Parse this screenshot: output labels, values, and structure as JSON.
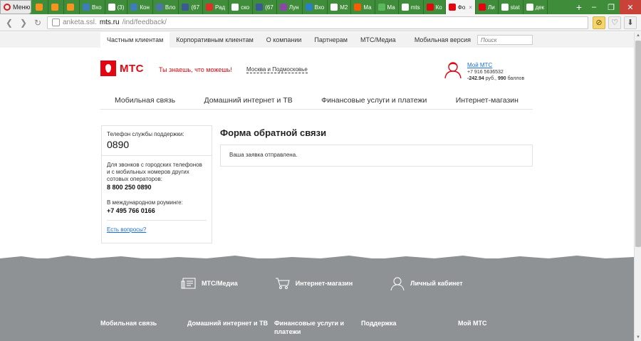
{
  "browser": {
    "menu_label": "Меню",
    "tabs": [
      {
        "label": "",
        "color": "#f7931e"
      },
      {
        "label": "",
        "color": "#f7931e"
      },
      {
        "label": "",
        "color": "#f7931e"
      },
      {
        "label": "Вхо",
        "color": "#3e7bbf"
      },
      {
        "label": "(3)",
        "color": "#ffffff"
      },
      {
        "label": "Кон",
        "color": "#3e7bbf"
      },
      {
        "label": "Вло",
        "color": "#4a76a8"
      },
      {
        "label": "(67",
        "color": "#3b5998"
      },
      {
        "label": "Рад",
        "color": "#e52d27"
      },
      {
        "label": "ско",
        "color": "#ffffff"
      },
      {
        "label": "(67",
        "color": "#3b5998"
      },
      {
        "label": "Лун",
        "color": "#8e44ad"
      },
      {
        "label": "Вхо",
        "color": "#2a7fc9"
      },
      {
        "label": "М2",
        "color": "#ffffff"
      },
      {
        "label": "Ма",
        "color": "#ff5a00"
      },
      {
        "label": "Ма",
        "color": "#5cb85c"
      },
      {
        "label": "mts",
        "color": "#ffffff"
      },
      {
        "label": "Ко",
        "color": "#e30611"
      },
      {
        "label": "Фо",
        "color": "#e30611",
        "active": true
      },
      {
        "label": "Ли",
        "color": "#e30611"
      },
      {
        "label": "stat",
        "color": "#ffffff"
      },
      {
        "label": "дек",
        "color": "#ffffff"
      }
    ],
    "new_tab": "+",
    "url_prefix": "anketa.ssl.",
    "url_host": "mts.ru",
    "url_path": "/ind/feedback/",
    "back_icon": "back-arrow-icon",
    "forward_icon": "forward-arrow-icon",
    "reload_icon": "reload-icon"
  },
  "topnav": {
    "items": [
      "Частным клиентам",
      "Корпоративным клиентам",
      "О компании",
      "Партнерам",
      "МТС/Медиа"
    ],
    "mobile": "Мобильная версия",
    "search_placeholder": "Поиск"
  },
  "header": {
    "logo_text": "МТС",
    "slogan": "Ты знаешь, что можешь!",
    "region": "Москва и Подмосковье",
    "account_title": "Мой МТС",
    "account_phone": "+7 916 5636532",
    "balance_amount": "-242.94",
    "balance_unit": " руб., ",
    "points_amount": "990",
    "points_unit": " баллов"
  },
  "mainnav": [
    "Мобильная связь",
    "Домашний интернет и ТВ",
    "Финансовые услуги и платежи",
    "Интернет-магазин"
  ],
  "support": {
    "label": "Телефон службы поддержки:",
    "short_number": "0890",
    "city_text": "Для звонков с городских телефонов и с мобильных номеров других сотовых операторов:",
    "city_number": "8 800 250 0890",
    "roaming_text": "В международном роуминге:",
    "roaming_number": "+7 495 766 0166",
    "link": "Есть вопросы?"
  },
  "feedback": {
    "title": "Форма обратной связи",
    "message": "Ваша заявка отправлена."
  },
  "footer": {
    "links": [
      "МТС/Медиа",
      "Интернет-магазин",
      "Личный кабинет"
    ],
    "columns": [
      "Мобильная связь",
      "Домашний интернет и ТВ",
      "Финансовые услуги и платежи",
      "Поддержка",
      "Мой МТС"
    ]
  }
}
